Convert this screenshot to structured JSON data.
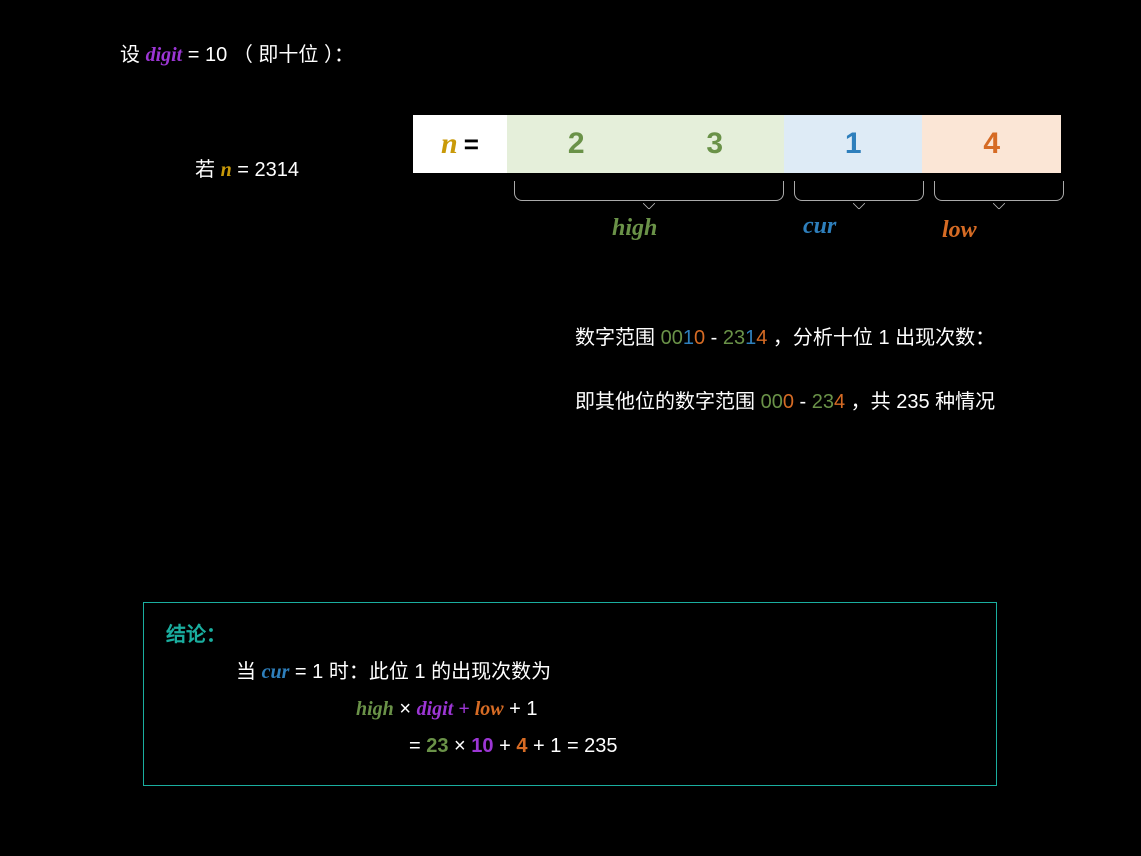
{
  "title_line": {
    "prefix": "设 ",
    "digit_var": "digit",
    "assign": " = 10 （ 即十位 ）："
  },
  "n_label_prefix": "若 ",
  "n_var": "n",
  "n_label_suffix": " = 2314",
  "diagram": {
    "n_sym": "n",
    "eq": "=",
    "d1": "2",
    "d2": "3",
    "d3": "1",
    "d4": "4",
    "high_label": "high",
    "cur_label": "cur",
    "low_label": "low"
  },
  "para1": {
    "l1a": "数字范围 ",
    "l1b": "0010",
    "l1c": " - ",
    "l1d": "2314",
    "l1e": " ，分析十位 1 出现次数：",
    "l2a": "即其他位的数字范围 ",
    "l2b": "000",
    "l2c": " - ",
    "l2d": "234",
    "l2e": " ，共 235 种情况"
  },
  "conclusion": {
    "header": "结论：",
    "l1a": "当 ",
    "l1b": "cur",
    "l1c": " = 1 时：此位 1 的出现次数为",
    "l2a": "high",
    "l2b": " × ",
    "l2c": "digit",
    "l2d": " + ",
    "l2e": "low",
    "l2f": " + 1",
    "l3a": "= ",
    "l3b": "23",
    "l3c": " × ",
    "l3d": "10",
    "l3e": " + ",
    "l3f": "4",
    "l3g": " + 1 = 235"
  }
}
